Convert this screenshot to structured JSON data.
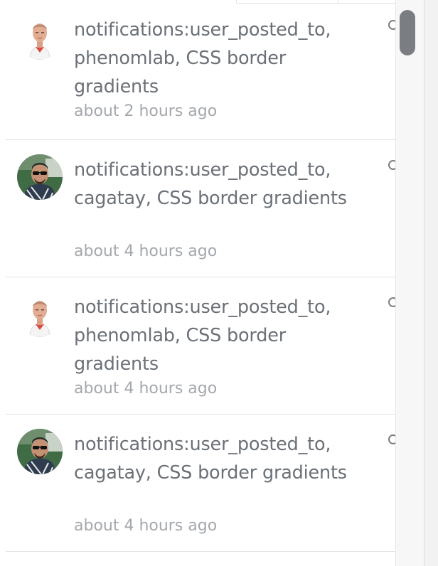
{
  "notifications": [
    {
      "user": "phenomlab",
      "avatar_icon": "man-portrait-icon",
      "text": "notifications:user_posted_to, phenomlab, CSS border gradients",
      "time": "about 2 hours ago"
    },
    {
      "user": "cagatay",
      "avatar_icon": "man-sunglasses-portrait-icon",
      "text": "notifications:user_posted_to, cagatay, CSS border gradients",
      "time": "about 4 hours ago"
    },
    {
      "user": "phenomlab",
      "avatar_icon": "man-portrait-icon",
      "text": "notifications:user_posted_to, phenomlab, CSS border gradients",
      "time": "about 4 hours ago"
    },
    {
      "user": "cagatay",
      "avatar_icon": "man-sunglasses-portrait-icon",
      "text": "notifications:user_posted_to, cagatay, CSS border gradients",
      "time": "about 4 hours ago"
    }
  ],
  "colors": {
    "text": "#6b7177",
    "time": "#a4a8ac",
    "scroll_thumb": "#7a7e82",
    "divider": "#e2e2e2"
  }
}
